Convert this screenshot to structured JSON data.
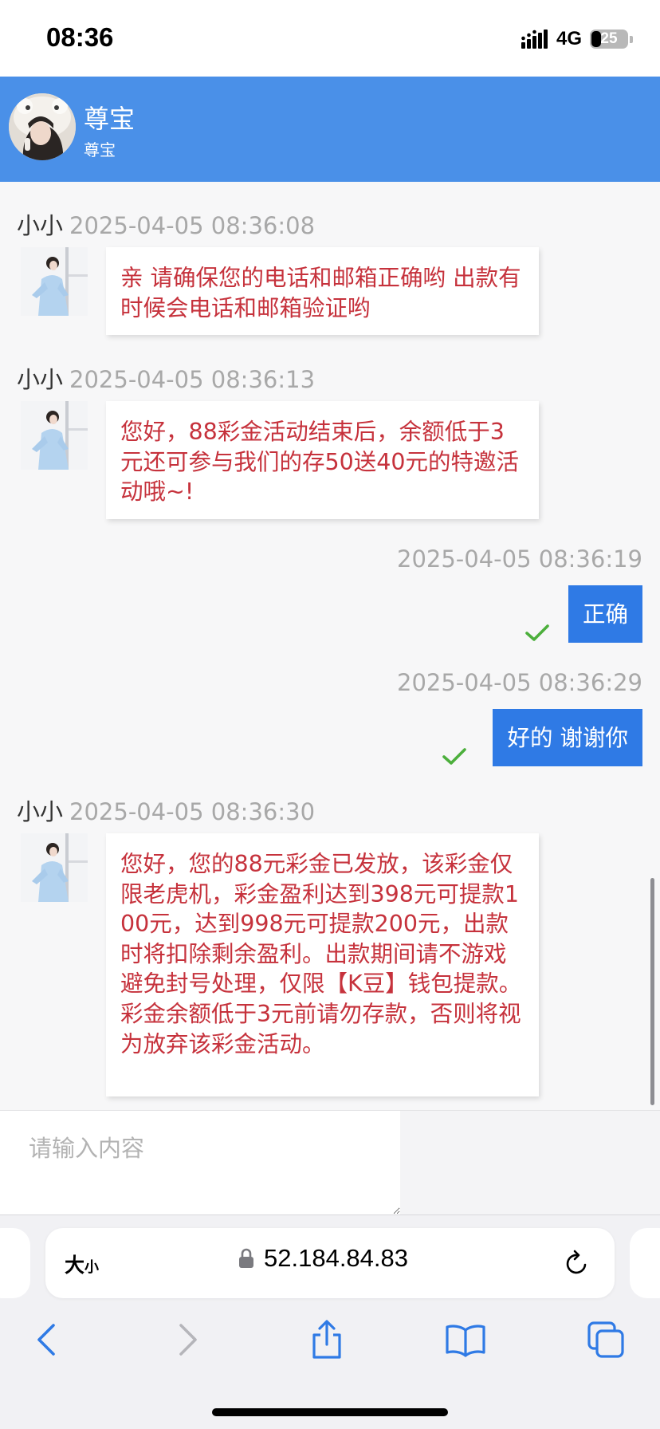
{
  "status_bar": {
    "time": "08:36",
    "network": "4G",
    "battery": "25"
  },
  "header": {
    "name": "尊宝",
    "subtitle": "尊宝"
  },
  "messages": [
    {
      "sender": "小小",
      "time": "2025-04-05 08:36:08",
      "text": "亲 请确保您的电话和邮箱正确哟 出款有时候会电话和邮箱验证哟"
    },
    {
      "sender": "小小",
      "time": "2025-04-05 08:36:13",
      "text": "您好，88彩金活动结束后，余额低于3元还可参与我们的存50送40元的特邀活动哦~!"
    },
    {
      "time": "2025-04-05 08:36:19",
      "text": "正确"
    },
    {
      "time": "2025-04-05 08:36:29",
      "text": "好的 谢谢你"
    },
    {
      "sender": "小小",
      "time": "2025-04-05 08:36:30",
      "text": "您好，您的88元彩金已发放，该彩金仅限老虎机，彩金盈利达到398元可提款100元，达到998元可提款200元，出款时将扣除剩余盈利。出款期间请不游戏避免封号处理，仅限【K豆】钱包提款。彩金余额低于3元前请勿存款，否则将视为放弃该彩金活动。"
    }
  ],
  "input": {
    "placeholder": "请输入内容"
  },
  "browser": {
    "aa_big": "大",
    "aa_small": "小",
    "url": "52.184.84.83"
  },
  "colors": {
    "header": "#4a90e8",
    "outgoing_bubble": "#2f7ae5",
    "incoming_text": "#c6323c",
    "read_check": "#4caf3c"
  },
  "icons": [
    "lock-icon",
    "reload-icon",
    "back-icon",
    "forward-icon",
    "share-icon",
    "bookmarks-icon",
    "tabs-icon",
    "signal-icon",
    "battery-icon",
    "read-check-icon"
  ]
}
